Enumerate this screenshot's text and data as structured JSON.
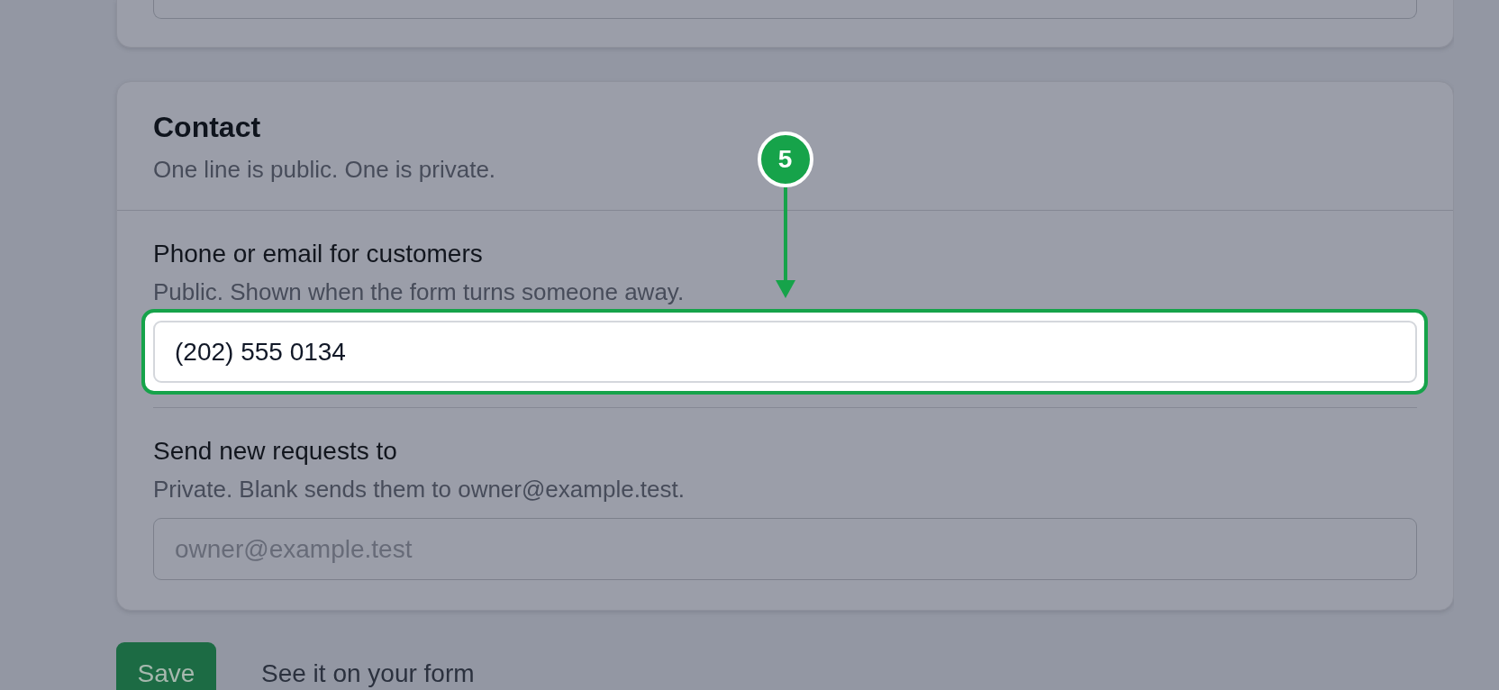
{
  "section": {
    "title": "Contact",
    "subtitle": "One line is public. One is private.",
    "fields": [
      {
        "label": "Phone or email for customers",
        "hint": "Public. Shown when the form turns someone away.",
        "value": "(202) 555 0134",
        "highlighted": true,
        "callout": {
          "number": "5"
        }
      },
      {
        "label": "Send new requests to",
        "hint": "Private. Blank sends them to owner@example.test.",
        "placeholder": "owner@example.test",
        "highlighted": false
      }
    ]
  },
  "actions": [
    {
      "kind": "primary",
      "label": "Save"
    },
    {
      "kind": "link",
      "label": "See it on your form"
    }
  ]
}
